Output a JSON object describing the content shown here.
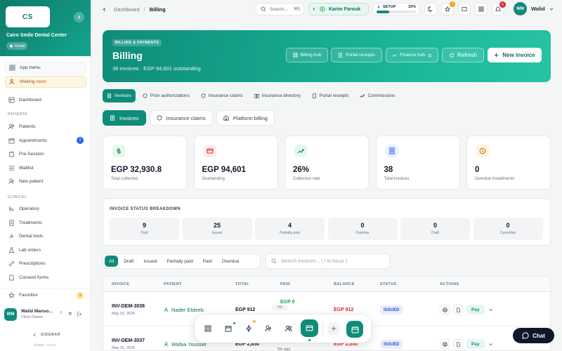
{
  "sidebar": {
    "logo": "CS",
    "clinic_name": "Cairo Smile Dental Center",
    "clinic_tag": "Dental",
    "app_menu": "App menu",
    "waiting_room": "Waiting room",
    "dashboard": "Dashboard",
    "patients_section": "PATIENTS",
    "clinical_section": "CLINICAL",
    "items_patients": [
      {
        "label": "Patients",
        "icon": "users-icon"
      },
      {
        "label": "Appointments",
        "icon": "calendar-icon",
        "badge": "2"
      },
      {
        "label": "Pre-Session",
        "icon": "clipboard-icon"
      },
      {
        "label": "Waitlist",
        "icon": "list-icon"
      },
      {
        "label": "New patient",
        "icon": "user-plus-icon"
      }
    ],
    "items_clinical": [
      {
        "label": "Operatory",
        "icon": "chair-icon"
      },
      {
        "label": "Treatments",
        "icon": "doc-icon"
      },
      {
        "label": "Dental tools",
        "icon": "tool-icon"
      },
      {
        "label": "Lab orders",
        "icon": "flask-icon"
      },
      {
        "label": "Prescriptions",
        "icon": "link-icon"
      },
      {
        "label": "Consent forms",
        "icon": "file-icon"
      }
    ],
    "favorites": "Favorites",
    "favorites_count": "1",
    "user_initials": "WM",
    "user_name": "Walid Manso...",
    "user_role": "Clinic Owner",
    "collapse_label": "SIDEBAR",
    "version": "ClinMS - v1.0.0"
  },
  "topbar": {
    "crumb_parent": "Dashboard",
    "crumb_current": "Billing",
    "search_placeholder": "Search...",
    "search_kbd": "⌘K",
    "active_patient": "Karim Farouk",
    "setup_label": "SETUP",
    "setup_percent": "33%",
    "setup_progress": 0.33,
    "star_badge": "1",
    "notif_badge": "6",
    "user_initials": "WM",
    "user_name": "Walid"
  },
  "hero": {
    "eyebrow": "BILLING & PAYMENTS",
    "title": "Billing",
    "subtitle": "38 invoices · EGP 94,601 outstanding",
    "btn_billing_hub": "Billing hub",
    "btn_portal": "Portal receipts",
    "btn_finance": "Finance hub",
    "btn_refresh": "Refresh",
    "btn_new": "New invoice"
  },
  "tabs_top": [
    "Invoices",
    "Prior authorizations",
    "Insurance claims",
    "Insurance directory",
    "Portal receipts",
    "Commissions"
  ],
  "tabs_sub": [
    "Invoices",
    "Insurance claims",
    "Platform billing"
  ],
  "stats": [
    {
      "value": "EGP 32,930.8",
      "label": "Total collected",
      "color": "#16a34a",
      "bg": "#e7f6ee",
      "icon": "dollar-icon"
    },
    {
      "value": "EGP 94,601",
      "label": "Outstanding",
      "color": "#dc2626",
      "bg": "#fdecec",
      "icon": "card-icon"
    },
    {
      "value": "26%",
      "label": "Collection rate",
      "color": "#0f8c79",
      "bg": "#e6f6f2",
      "icon": "trend-icon"
    },
    {
      "value": "38",
      "label": "Total invoices",
      "color": "#2563eb",
      "bg": "#e8effd",
      "icon": "invoice-icon"
    },
    {
      "value": "0",
      "label": "Overdue installments",
      "color": "#d97706",
      "bg": "#fdf3e3",
      "icon": "clock-icon"
    }
  ],
  "breakdown": {
    "title": "INVOICE STATUS BREAKDOWN",
    "items": [
      {
        "value": "9",
        "label": "Paid"
      },
      {
        "value": "25",
        "label": "Issued"
      },
      {
        "value": "4",
        "label": "Partially paid"
      },
      {
        "value": "0",
        "label": "Overdue"
      },
      {
        "value": "0",
        "label": "Draft"
      },
      {
        "value": "0",
        "label": "Cancelled"
      }
    ]
  },
  "filters": [
    "All",
    "Draft",
    "Issued",
    "Partially paid",
    "Paid",
    "Overdue"
  ],
  "search_invoices": "Search invoices... ( / to focus )",
  "table": {
    "headers": [
      "INVOICE",
      "PATIENT",
      "TOTAL",
      "PAID",
      "BALANCE",
      "STATUS",
      "ACTIONS"
    ],
    "rows": [
      {
        "invoice": "INV-DEM-3038",
        "date": "May 31, 2026",
        "patient": "Nader Eldeeb",
        "total": "EGP 912",
        "paid": "EGP 0",
        "paid_note": "0%",
        "balance": "EGP 912",
        "status": "ISSUED",
        "action": "Pay"
      },
      {
        "invoice": "INV-DEM-3037",
        "date": "May 31, 2026",
        "patient": "Wafaa Youssef",
        "total": "EGP 2,850",
        "paid": "",
        "paid_note": "0% paid",
        "balance": "EGP 2,850",
        "status": "ISSUED",
        "action": "Pay"
      }
    ]
  },
  "chat_label": "Chat"
}
